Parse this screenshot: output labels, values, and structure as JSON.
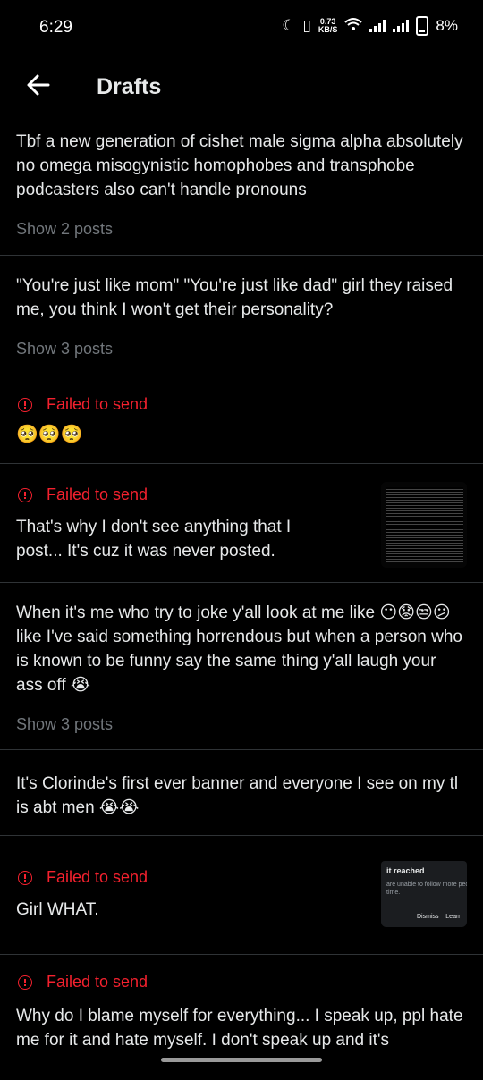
{
  "status": {
    "time": "6:29",
    "net_speed_value": "0.73",
    "net_speed_unit": "KB/S",
    "battery": "8%"
  },
  "header": {
    "title": "Drafts"
  },
  "drafts": [
    {
      "text": "Tbf a new generation of cishet male sigma alpha absolutely no omega misogynistic homophobes and transphobe podcasters also can't handle pronouns",
      "show": "Show 2 posts"
    },
    {
      "text": "\"You're just like mom\" \"You're just like dad\" girl they raised me, you think I won't get their personality?",
      "show": "Show 3 posts"
    },
    {
      "failed": "Failed to send",
      "text": "🥺🥺🥺"
    },
    {
      "failed": "Failed to send",
      "text": "That's why I don't see anything that I post... It's cuz it was never posted."
    },
    {
      "text": "When it's me who try to joke y'all look at me like 😶😟😒😕 like I've said something horrendous but when a person who is known to be funny say the same thing y'all laugh your ass off 😭",
      "show": "Show 3 posts"
    },
    {
      "text": "It's Clorinde's first ever banner and everyone I see on my tl is abt men 😭😭"
    },
    {
      "failed": "Failed to send",
      "text": "Girl WHAT.",
      "thumb": {
        "title": "it reached",
        "body1": "are unable to follow more peop",
        "body2": "time.",
        "dismiss": "Dismiss",
        "learn": "Learr"
      }
    },
    {
      "failed": "Failed to send",
      "text": "Why do I blame myself for everything... I speak up, ppl hate me for it and hate myself. I don't speak up and it's"
    }
  ],
  "colors": {
    "background": "#000000",
    "text": "#e7e9ea",
    "muted": "#71767b",
    "error": "#f4212e",
    "divider": "#2f3336"
  }
}
